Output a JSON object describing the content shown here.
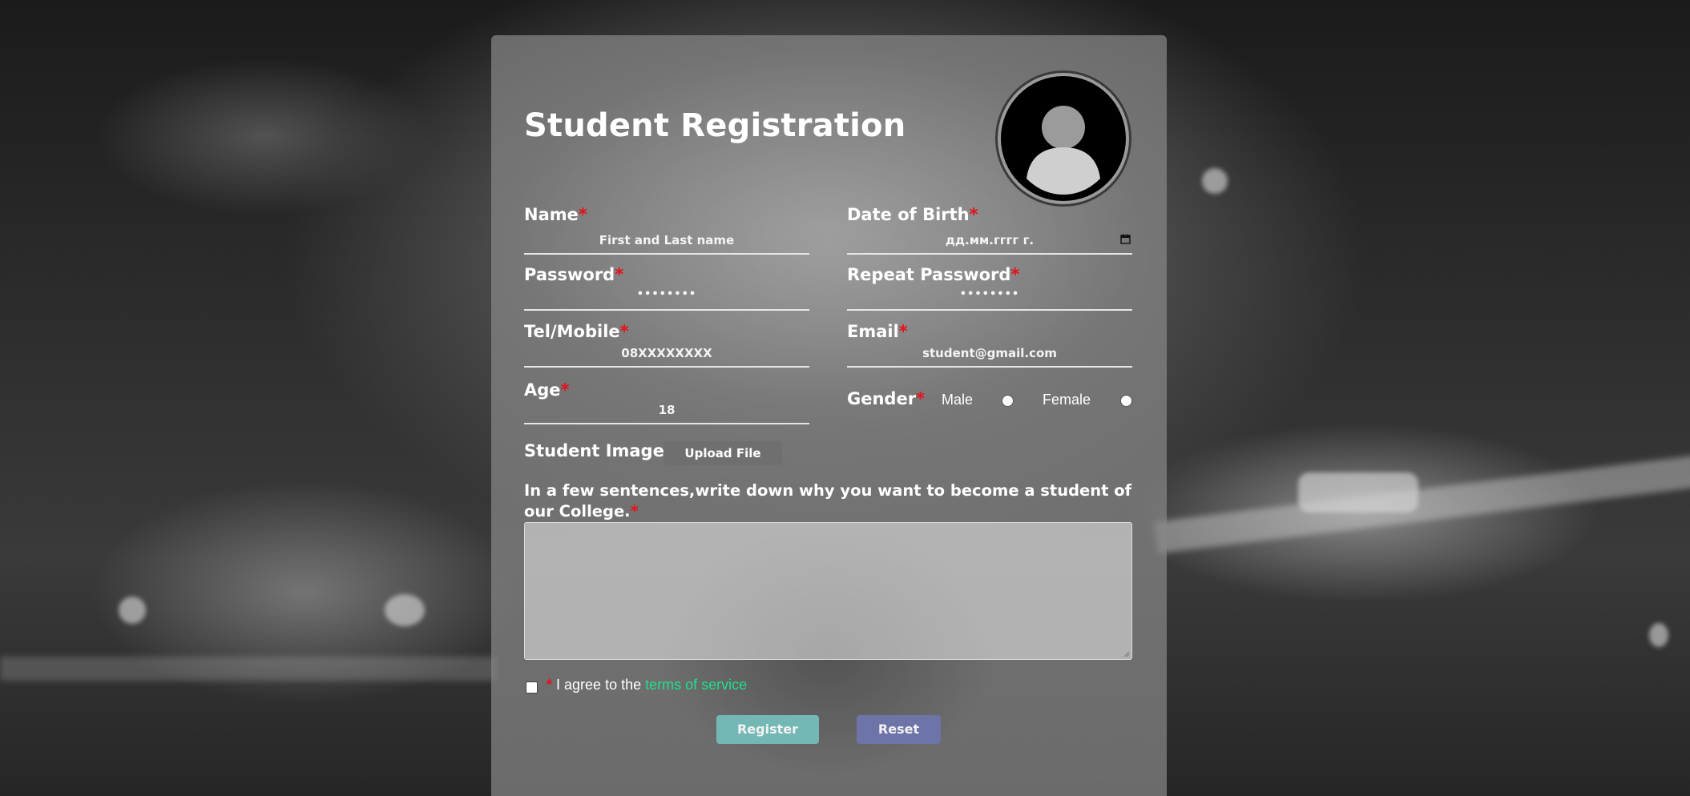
{
  "form": {
    "title": "Student Registration",
    "required_mark": "*",
    "fields": {
      "name": {
        "label": "Name",
        "placeholder": "First and Last name"
      },
      "dob": {
        "label": "Date of Birth",
        "placeholder": "дд.мм.гггг г."
      },
      "password": {
        "label": "Password",
        "value": "••••••••"
      },
      "repeat_password": {
        "label": "Repeat Password",
        "value": "••••••••"
      },
      "tel": {
        "label": "Tel/Mobile",
        "placeholder": "08XXXXXXXX"
      },
      "email": {
        "label": "Email",
        "placeholder": "student@gmail.com"
      },
      "age": {
        "label": "Age",
        "value": "18"
      },
      "gender": {
        "label": "Gender",
        "options": [
          "Male",
          "Female"
        ]
      }
    },
    "student_image": {
      "label": "Student Image",
      "button": "Upload File"
    },
    "essay": {
      "label": "In a few sentences,write down why you want to become a student of our College.",
      "value": ""
    },
    "terms": {
      "prefix": "I agree to the ",
      "link": "terms of service",
      "checked": false
    },
    "buttons": {
      "register": "Register",
      "reset": "Reset"
    }
  },
  "colors": {
    "required": "#e8101a",
    "terms_link": "#1fe08f",
    "register_button": "#74b8b5",
    "reset_button": "#6d74a8",
    "upload_button": "#6f6f6f"
  },
  "icons": {
    "avatar": "user-avatar-icon",
    "date_picker": "calendar-icon"
  }
}
